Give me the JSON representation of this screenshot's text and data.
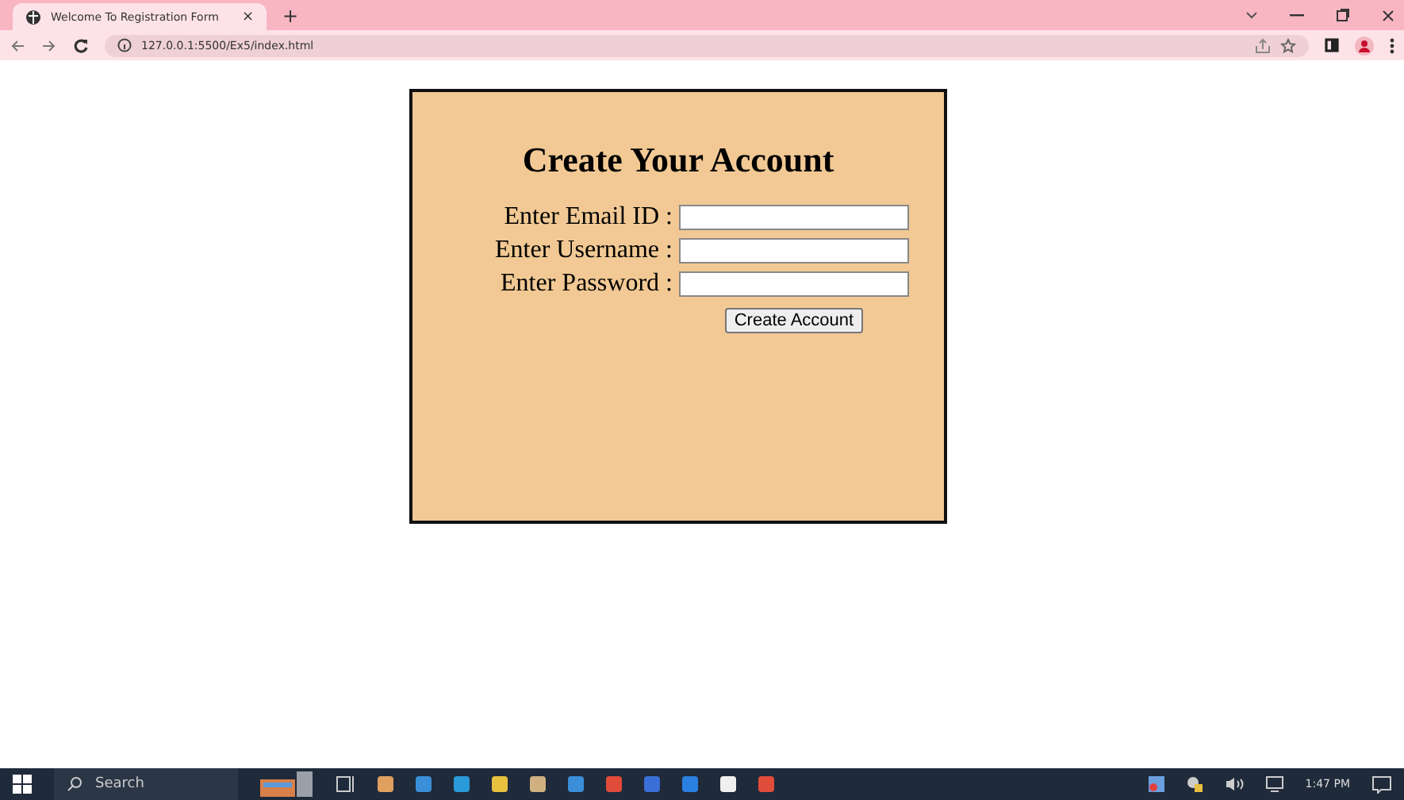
{
  "browser": {
    "tab_title": "Welcome To Registration Form",
    "close_tab": "×",
    "new_tab": "+",
    "url": "127.0.0.1:5500/Ex5/index.html"
  },
  "form": {
    "title": "Create Your Account",
    "fields": [
      {
        "label": "Enter Email ID :"
      },
      {
        "label": "Enter Username :"
      },
      {
        "label": "Enter Password :"
      }
    ],
    "submit": "Create Account"
  },
  "taskbar": {
    "search": "Search",
    "time": "1:47 PM"
  }
}
